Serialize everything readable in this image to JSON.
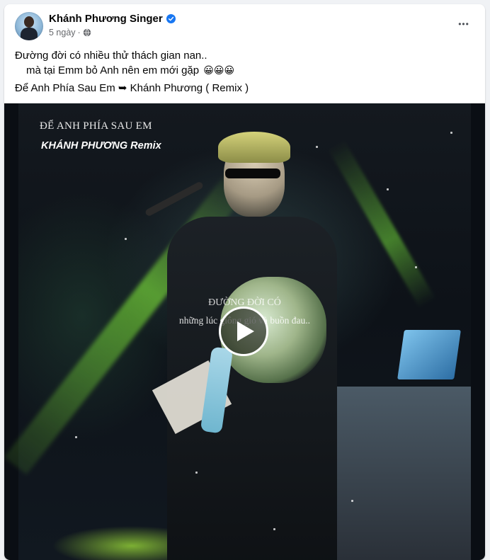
{
  "post": {
    "author": "Khánh Phương Singer",
    "verified": true,
    "time": "5 ngày",
    "separator": "·",
    "audience_icon": "globe-icon",
    "more_icon": "more-horizontal-icon",
    "more_label": "•••",
    "text_line1": "Đường đời có nhiều thử thách gian nan..",
    "text_line2": "mà tại Emm bỏ Anh nên em mới gặp",
    "emojis": "😀😀😀",
    "song_line": "Để Anh Phía Sau Em ➥ Khánh Phương ( Remix )"
  },
  "video": {
    "title": "ĐỂ ANH PHÍA SAU EM",
    "subtitle": "KHÁNH PHƯƠNG Remix",
    "lyric_line1": "ĐƯỜNG ĐỜI CÓ",
    "lyric_line2": "những lúc giông gió và buồn đau..",
    "play_icon": "play-icon"
  },
  "colors": {
    "verified_badge": "#1877f2",
    "secondary_text": "#65676b",
    "stage_green": "#9ef04a"
  }
}
